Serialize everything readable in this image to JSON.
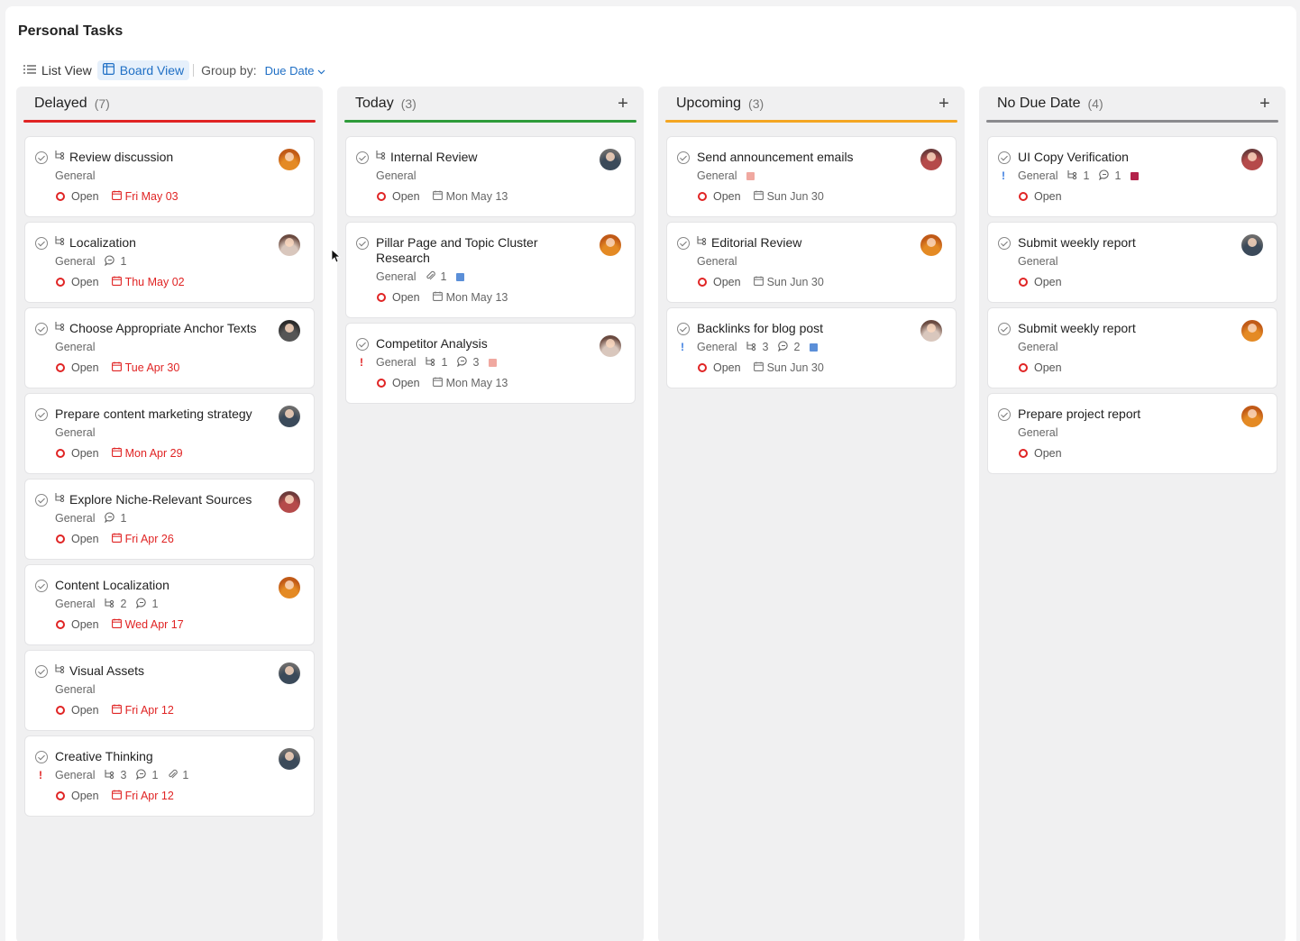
{
  "page_title": "Personal Tasks",
  "toolbar": {
    "list_view": "List View",
    "board_view": "Board View",
    "group_by_label": "Group by:",
    "group_by_value": "Due Date"
  },
  "colors": {
    "accent": "#1f6fc5",
    "delayed": "#e02424",
    "today": "#2e9b3a",
    "upcoming": "#f4a623",
    "no_due": "#8a8a8e",
    "tag_pink": "#f0a8a0",
    "tag_blue": "#5b8fd8",
    "tag_crimson": "#b3214a"
  },
  "columns": [
    {
      "title": "Delayed",
      "count": "(7)",
      "has_add": false,
      "cards": [
        {
          "title": "Review discussion",
          "subtask": true,
          "project": "General",
          "status": "Open",
          "due": "Fri May 03",
          "avatar": "av1"
        },
        {
          "title": "Localization",
          "subtask": true,
          "project": "General",
          "comments": "1",
          "status": "Open",
          "due": "Thu May 02",
          "avatar": "av3"
        },
        {
          "title": "Choose Appropriate Anchor Texts",
          "subtask": true,
          "project": "General",
          "status": "Open",
          "due": "Tue Apr 30",
          "avatar": "av5"
        },
        {
          "title": "Prepare content marketing strategy",
          "subtask": false,
          "project": "General",
          "status": "Open",
          "due": "Mon Apr 29",
          "avatar": "av2"
        },
        {
          "title": "Explore Niche-Relevant Sources",
          "subtask": true,
          "project": "General",
          "comments": "1",
          "status": "Open",
          "due": "Fri Apr 26",
          "avatar": "av4"
        },
        {
          "title": "Content Localization",
          "subtask": false,
          "project": "General",
          "subtasks": "2",
          "comments": "1",
          "status": "Open",
          "due": "Wed Apr 17",
          "avatar": "av1"
        },
        {
          "title": "Visual Assets",
          "subtask": true,
          "project": "General",
          "status": "Open",
          "due": "Fri Apr 12",
          "avatar": "av2"
        },
        {
          "title": "Creative Thinking",
          "subtask": false,
          "priority": "!",
          "project": "General",
          "subtasks": "3",
          "comments": "1",
          "attachments": "1",
          "status": "Open",
          "due": "Fri Apr 12",
          "avatar": "av2"
        }
      ]
    },
    {
      "title": "Today",
      "count": "(3)",
      "has_add": true,
      "add": "+",
      "cards": [
        {
          "title": "Internal Review",
          "subtask": true,
          "project": "General",
          "status": "Open",
          "due": "Mon May 13",
          "avatar": "av2"
        },
        {
          "title": "Pillar Page and Topic Cluster Research",
          "subtask": false,
          "project": "General",
          "attachments": "1",
          "tag": "tag_blue",
          "status": "Open",
          "due": "Mon May 13",
          "avatar": "av1"
        },
        {
          "title": "Competitor Analysis",
          "subtask": false,
          "priority": "!",
          "project": "General",
          "subtasks": "1",
          "comments": "3",
          "tag": "tag_pink",
          "status": "Open",
          "due": "Mon May 13",
          "avatar": "av3"
        }
      ]
    },
    {
      "title": "Upcoming",
      "count": "(3)",
      "has_add": true,
      "add": "+",
      "cards": [
        {
          "title": "Send announcement emails",
          "subtask": false,
          "project": "General",
          "tag": "tag_pink",
          "status": "Open",
          "due": "Sun Jun 30",
          "avatar": "av4"
        },
        {
          "title": "Editorial Review",
          "subtask": true,
          "project": "General",
          "status": "Open",
          "due": "Sun Jun 30",
          "avatar": "av1"
        },
        {
          "title": "Backlinks for blog post",
          "subtask": false,
          "priority": "!",
          "project": "General",
          "subtasks": "3",
          "comments": "2",
          "tag": "tag_blue",
          "status": "Open",
          "due": "Sun Jun 30",
          "avatar": "av3"
        }
      ]
    },
    {
      "title": "No Due Date",
      "count": "(4)",
      "has_add": true,
      "add": "+",
      "cards": [
        {
          "title": "UI Copy Verification",
          "subtask": false,
          "priority": "!",
          "project": "General",
          "subtasks": "1",
          "comments": "1",
          "tag": "tag_crimson",
          "status": "Open",
          "avatar": "av4"
        },
        {
          "title": "Submit weekly report",
          "subtask": false,
          "project": "General",
          "status": "Open",
          "avatar": "av2"
        },
        {
          "title": "Submit weekly report",
          "subtask": false,
          "project": "General",
          "status": "Open",
          "avatar": "av1"
        },
        {
          "title": "Prepare project report",
          "subtask": false,
          "project": "General",
          "status": "Open",
          "avatar": "av1"
        }
      ]
    }
  ]
}
